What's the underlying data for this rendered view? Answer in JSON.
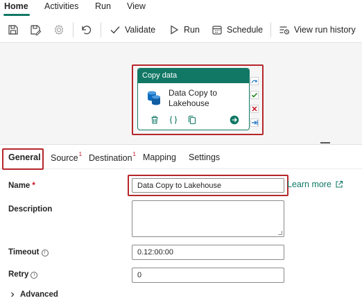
{
  "menu": {
    "tabs": [
      {
        "label": "Home",
        "active": true
      },
      {
        "label": "Activities"
      },
      {
        "label": "Run"
      },
      {
        "label": "View"
      }
    ]
  },
  "toolbar": {
    "icons": [
      "save-icon",
      "save-as-icon",
      "settings-icon",
      "undo-icon"
    ],
    "validate_label": "Validate",
    "run_label": "Run",
    "schedule_label": "Schedule",
    "view_run_history_label": "View run history"
  },
  "canvas": {
    "activity": {
      "type_label": "Copy data",
      "name": "Data Copy to Lakehouse",
      "footer_icons": [
        "delete-icon",
        "code-icon",
        "copy-icon",
        "go-icon"
      ]
    },
    "side_icons": [
      "skip-icon",
      "success-icon",
      "failure-icon",
      "completion-icon"
    ]
  },
  "properties": {
    "tabs": [
      {
        "label": "General",
        "active": true,
        "badge": ""
      },
      {
        "label": "Source",
        "badge": "1"
      },
      {
        "label": "Destination",
        "badge": "1"
      },
      {
        "label": "Mapping",
        "badge": ""
      },
      {
        "label": "Settings",
        "badge": ""
      }
    ]
  },
  "form": {
    "name_label": "Name",
    "required_mark": "*",
    "name_value": "Data Copy to Lakehouse",
    "learn_more_label": "Learn more",
    "description_label": "Description",
    "description_value": "",
    "timeout_label": "Timeout",
    "timeout_value": "0.12:00:00",
    "retry_label": "Retry",
    "retry_value": "0",
    "info_glyph": "i",
    "advanced_label": "Advanced"
  },
  "colors": {
    "accent": "#117865",
    "highlight": "#b5262a",
    "required": "#c50f1f"
  }
}
